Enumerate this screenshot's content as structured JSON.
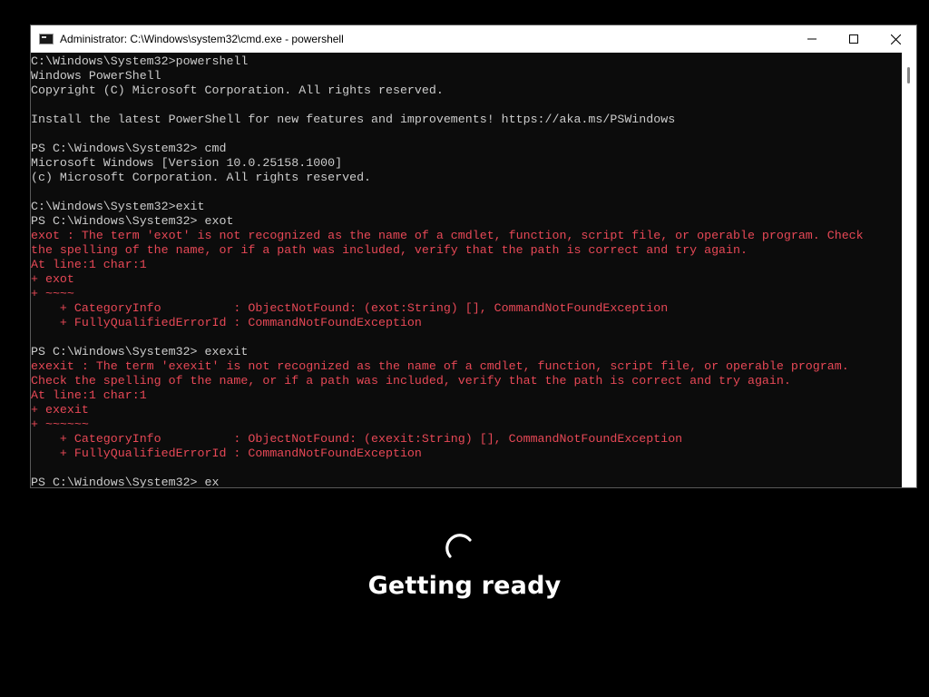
{
  "window": {
    "title": "Administrator: C:\\Windows\\system32\\cmd.exe - powershell",
    "icon": "cmd-icon"
  },
  "console": {
    "lines": [
      {
        "text": "C:\\Windows\\System32>powershell",
        "type": "normal"
      },
      {
        "text": "Windows PowerShell",
        "type": "normal"
      },
      {
        "text": "Copyright (C) Microsoft Corporation. All rights reserved.",
        "type": "normal"
      },
      {
        "text": "",
        "type": "normal"
      },
      {
        "text": "Install the latest PowerShell for new features and improvements! https://aka.ms/PSWindows",
        "type": "normal"
      },
      {
        "text": "",
        "type": "normal"
      },
      {
        "text": "PS C:\\Windows\\System32> cmd",
        "type": "normal"
      },
      {
        "text": "Microsoft Windows [Version 10.0.25158.1000]",
        "type": "normal"
      },
      {
        "text": "(c) Microsoft Corporation. All rights reserved.",
        "type": "normal"
      },
      {
        "text": "",
        "type": "normal"
      },
      {
        "text": "C:\\Windows\\System32>exit",
        "type": "normal"
      },
      {
        "text": "PS C:\\Windows\\System32> exot",
        "type": "normal"
      },
      {
        "text": "exot : The term 'exot' is not recognized as the name of a cmdlet, function, script file, or operable program. Check",
        "type": "error"
      },
      {
        "text": "the spelling of the name, or if a path was included, verify that the path is correct and try again.",
        "type": "error"
      },
      {
        "text": "At line:1 char:1",
        "type": "error"
      },
      {
        "text": "+ exot",
        "type": "error"
      },
      {
        "text": "+ ~~~~",
        "type": "error"
      },
      {
        "text": "    + CategoryInfo          : ObjectNotFound: (exot:String) [], CommandNotFoundException",
        "type": "error"
      },
      {
        "text": "    + FullyQualifiedErrorId : CommandNotFoundException",
        "type": "error"
      },
      {
        "text": "",
        "type": "normal"
      },
      {
        "text": "PS C:\\Windows\\System32> exexit",
        "type": "normal"
      },
      {
        "text": "exexit : The term 'exexit' is not recognized as the name of a cmdlet, function, script file, or operable program.",
        "type": "error"
      },
      {
        "text": "Check the spelling of the name, or if a path was included, verify that the path is correct and try again.",
        "type": "error"
      },
      {
        "text": "At line:1 char:1",
        "type": "error"
      },
      {
        "text": "+ exexit",
        "type": "error"
      },
      {
        "text": "+ ~~~~~~",
        "type": "error"
      },
      {
        "text": "    + CategoryInfo          : ObjectNotFound: (exexit:String) [], CommandNotFoundException",
        "type": "error"
      },
      {
        "text": "    + FullyQualifiedErrorId : CommandNotFoundException",
        "type": "error"
      },
      {
        "text": "",
        "type": "normal"
      },
      {
        "text": "PS C:\\Windows\\System32> ex",
        "type": "normal"
      }
    ]
  },
  "overlay": {
    "status_text": "Getting ready",
    "spinner_icon": "loading-spinner-icon"
  },
  "colors": {
    "console_text": "#cccccc",
    "error_text": "#e74856",
    "console_bg": "#0c0c0c"
  }
}
